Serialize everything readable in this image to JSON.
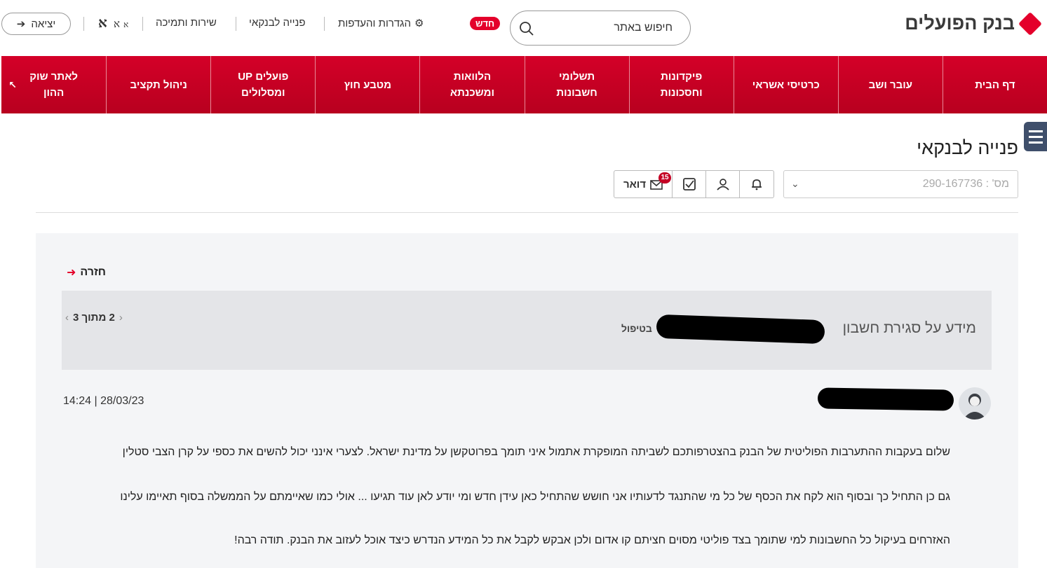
{
  "header": {
    "logo_text": "בנק הפועלים",
    "search_placeholder": "חיפוש באתר",
    "new_badge": "חדש",
    "settings_label": "הגדרות והעדפות",
    "contact_label": "פנייה לבנקאי",
    "service_label": "שירות ותמיכה",
    "font_small": "א",
    "font_medium": "א",
    "font_large": "א",
    "exit_label": "יציאה"
  },
  "nav": {
    "items": [
      {
        "label": "דף הבית"
      },
      {
        "label": "עובר ושב"
      },
      {
        "label": "כרטיסי אשראי"
      },
      {
        "label": "פיקדונות וחסכונות"
      },
      {
        "label": "תשלומי חשבונות"
      },
      {
        "label": "הלוואות ומשכנתא"
      },
      {
        "label": "מטבע חוץ"
      },
      {
        "label": "פועלים UP ומסלולים"
      },
      {
        "label": "ניהול תקציב"
      },
      {
        "label": "לאתר שוק ההון"
      }
    ]
  },
  "page": {
    "title": "פנייה לבנקאי",
    "account_value": "מס' : 290-167736",
    "mail_label": "דואר",
    "mail_count": "15"
  },
  "message": {
    "back_label": "חזרה",
    "subject": "מידע על סגירת חשבון",
    "status": "בטיפול",
    "pager": "2 מתוך 3",
    "timestamp": "14:24 | 28/03/23",
    "lines": [
      "שלום בעקבות ההתערבות הפוליטית של הבנק בהצטרפותכם לשביתה המופקרת אתמול איני תומך בפרוטקשן על מדינת ישראל. לצערי אינני יכול להשים את כספי על קרן הצבי סטלין",
      "גם כן התחיל כך ובסוף הוא לקח את הכסף של כל מי שהתנגד לדעותיו אני חושש שהתחיל כאן עידן חדש ומי יודע לאן עוד תגיעו ... אולי כמו שאיימתם על הממשלה בסוף תאיימו עלינו",
      "האזרחים בעיקול כל החשבונות למי שתומך בצד פוליטי מסוים חציתם קו אדום ולכן אבקש לקבל את כל המידע הנדרש כיצד אוכל לעזוב את הבנק. תודה רבה!"
    ]
  },
  "colors": {
    "brand_red": "#e4002b",
    "nav_red": "#c8001f",
    "menu_tab": "#3f4f6b"
  }
}
